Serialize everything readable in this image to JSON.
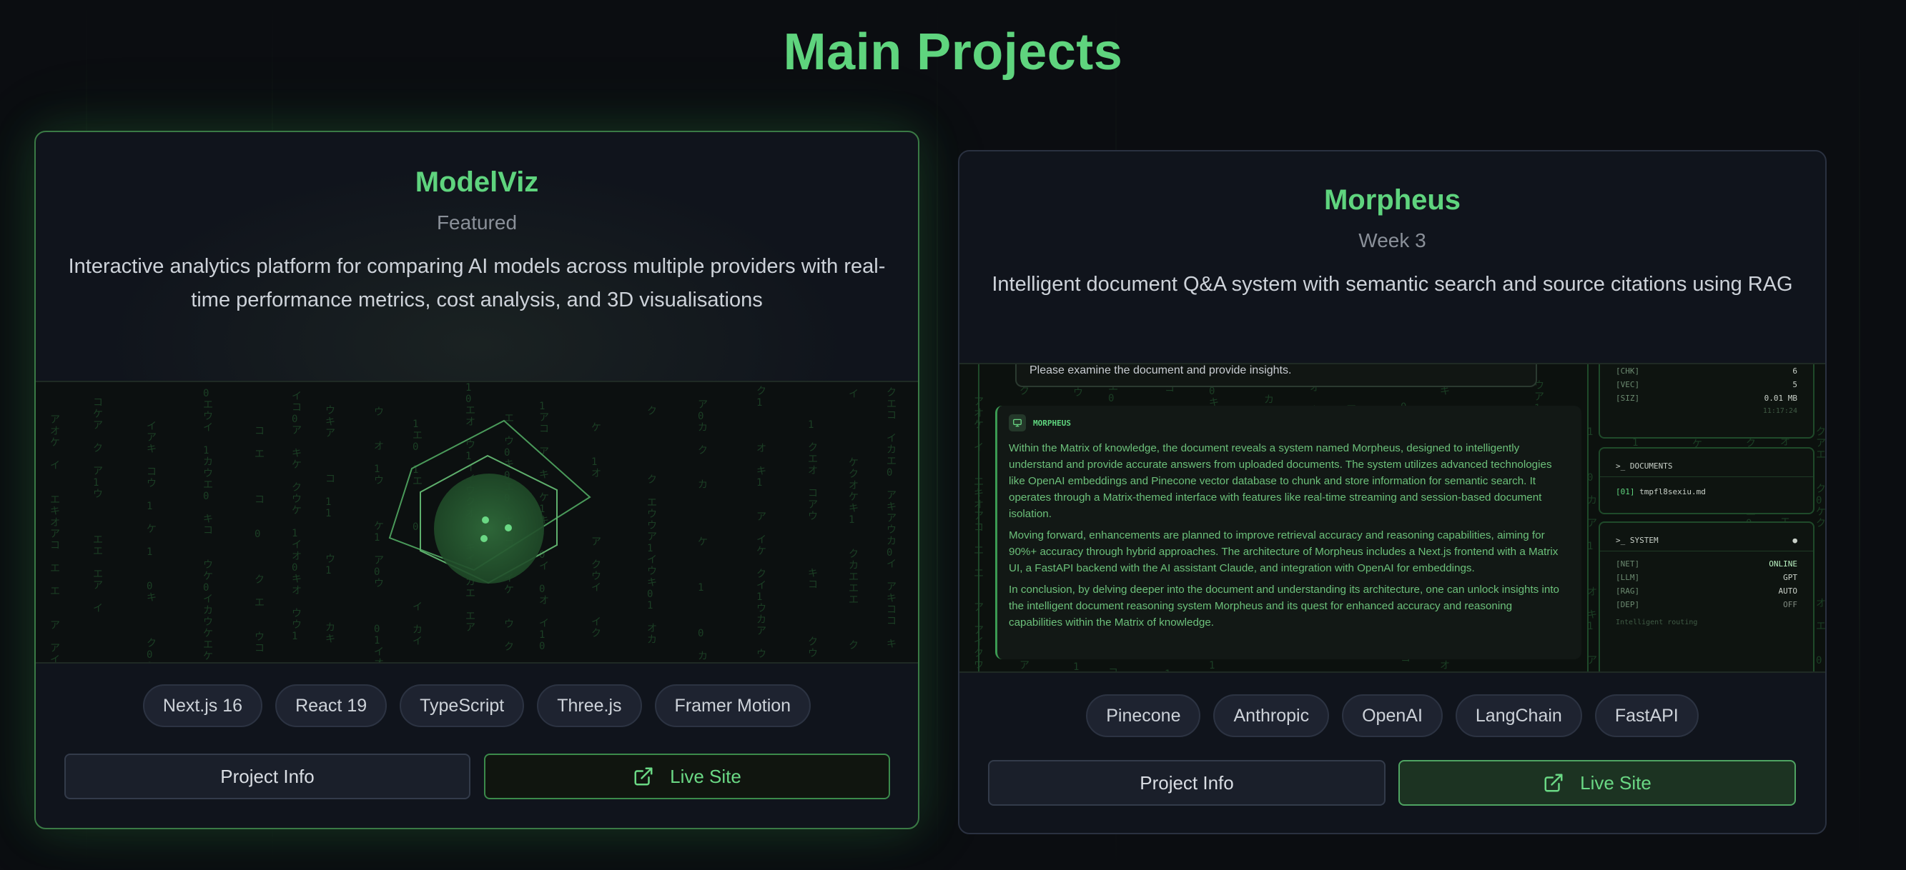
{
  "page": {
    "title": "Main Projects"
  },
  "colors": {
    "accent": "#5fd47e",
    "background": "#0b0d11",
    "card": "#10141c"
  },
  "projects": [
    {
      "title": "ModelViz",
      "subtitle": "Featured",
      "description": "Interactive analytics platform for comparing AI models across multiple providers with real-time performance metrics, cost analysis, and 3D visualisations",
      "tags": [
        "Next.js 16",
        "React 19",
        "TypeScript",
        "Three.js",
        "Framer Motion"
      ],
      "info_label": "Project Info",
      "live_label": "Live Site",
      "live_icon": "external-link-icon"
    },
    {
      "title": "Morpheus",
      "subtitle": "Week 3",
      "description": "Intelligent document Q&A system with semantic search and source citations using RAG",
      "tags": [
        "Pinecone",
        "Anthropic",
        "OpenAI",
        "LangChain",
        "FastAPI"
      ],
      "info_label": "Project Info",
      "live_label": "Live Site",
      "live_icon": "external-link-icon",
      "preview": {
        "user_message": "Please examine the document and provide insights.",
        "assistant_name": "MORPHEUS",
        "paragraphs": [
          "Within the Matrix of knowledge, the document reveals a system named Morpheus, designed to intelligently understand and provide accurate answers from uploaded documents. The system utilizes advanced technologies like OpenAI embeddings and Pinecone vector database to chunk and store information for semantic search. It operates through a Matrix-themed interface with features like real-time streaming and session-based document isolation.",
          "Moving forward, enhancements are planned to improve retrieval accuracy and reasoning capabilities, aiming for 90%+ accuracy through hybrid approaches. The architecture of Morpheus includes a Next.js frontend with a Matrix UI, a FastAPI backend with the AI assistant Claude, and integration with OpenAI for embeddings.",
          "In conclusion, by delving deeper into the document and understanding its architecture, one can unlock insights into the intelligent document reasoning system Morpheus and its quest for enhanced accuracy and reasoning capabilities within the Matrix of knowledge."
        ],
        "stats": [
          {
            "key": "[CHK]",
            "value": "6"
          },
          {
            "key": "[VEC]",
            "value": "5"
          },
          {
            "key": "[SIZ]",
            "value": "0.01 MB"
          }
        ],
        "stats_time": "11:17:24",
        "documents_title": ">_ DOCUMENTS",
        "documents": [
          {
            "num": "[01]",
            "name": "tmpfl8sexiu.md"
          }
        ],
        "system_title": ">_ SYSTEM",
        "system_indicator": "●",
        "system": [
          {
            "key": "[NET]",
            "value": "ONLINE",
            "state": "on"
          },
          {
            "key": "[LLM]",
            "value": "GPT",
            "state": "plain"
          },
          {
            "key": "[RAG]",
            "value": "AUTO",
            "state": "plain"
          },
          {
            "key": "[DEP]",
            "value": "OFF",
            "state": "off"
          }
        ],
        "system_footer": "Intelligent routing"
      }
    }
  ]
}
